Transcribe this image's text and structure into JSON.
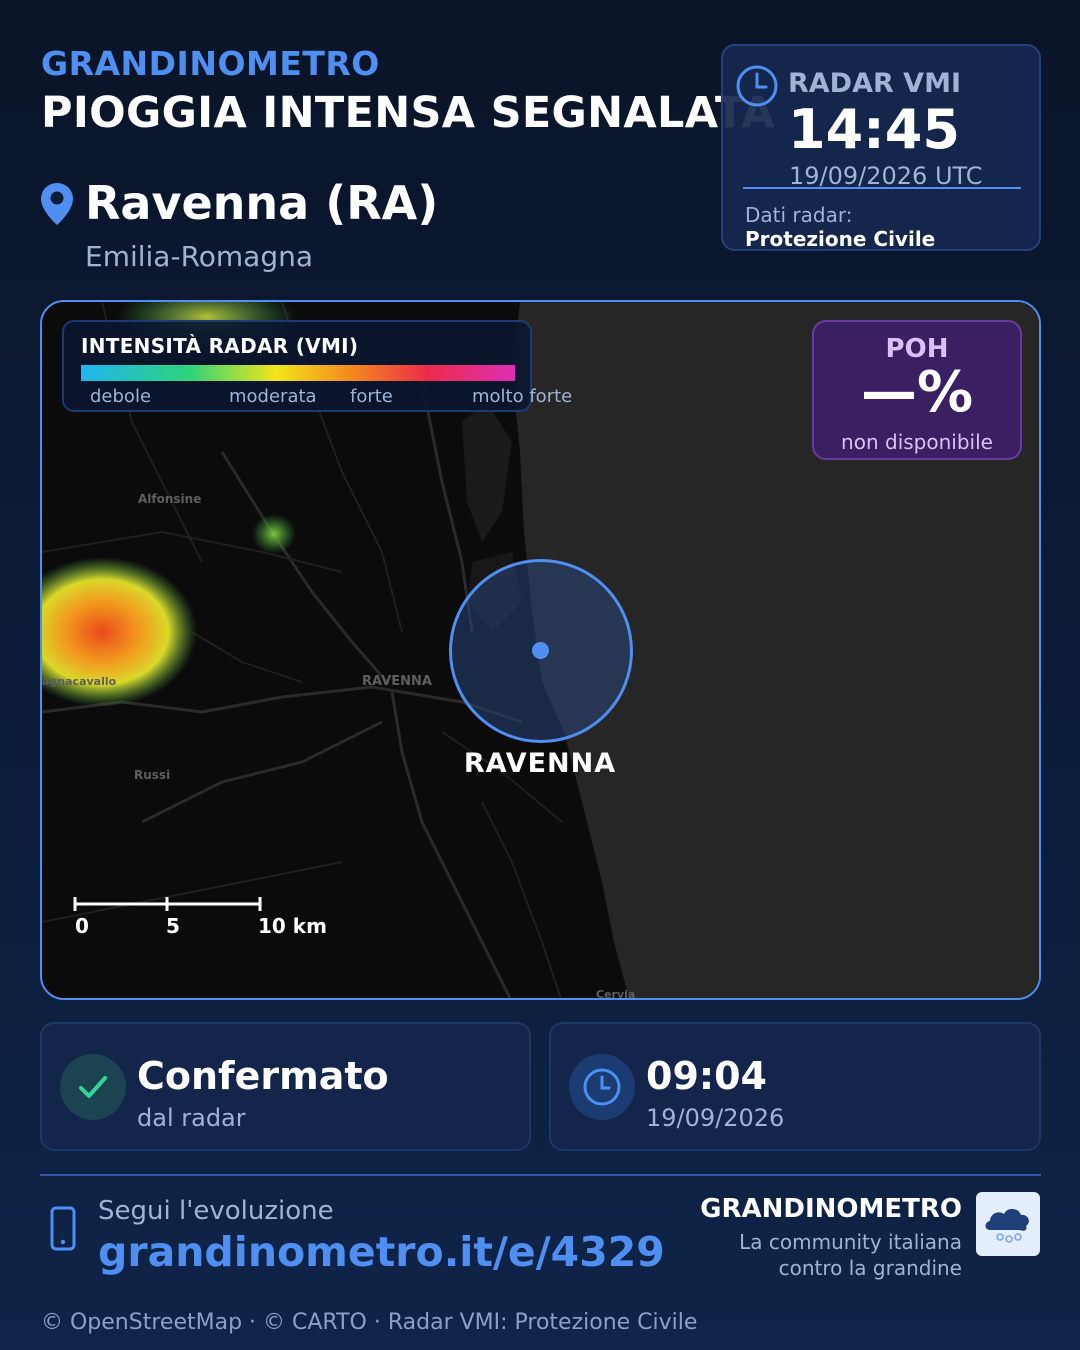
{
  "header": {
    "brand": "GRANDINOMETRO",
    "headline": "PIOGGIA INTENSA SEGNALATA",
    "city": "Ravenna (RA)",
    "region": "Emilia-Romagna"
  },
  "radar_card": {
    "label": "RADAR VMI",
    "time": "14:45",
    "date": "19/09/2026 UTC",
    "source_label": "Dati radar:",
    "source": "Protezione Civile"
  },
  "legend": {
    "title": "INTENSITÀ RADAR (VMI)",
    "labels": [
      "debole",
      "moderata",
      "forte",
      "molto forte"
    ],
    "colors": [
      "#21b5ef",
      "#2fd37a",
      "#f2e51a",
      "#f48a1e",
      "#ec2c4a",
      "#de2eb6"
    ]
  },
  "poh": {
    "label": "POH",
    "value": "—%",
    "note": "non disponibile"
  },
  "map": {
    "location_label": "RAVENNA",
    "scale": [
      "0",
      "5",
      "10 km"
    ],
    "places": [
      "Alfonsine",
      "RAVENNA",
      "Russi",
      "agnacavallo",
      "Cervia"
    ]
  },
  "status_card": {
    "title": "Confermato",
    "subtitle": "dal radar"
  },
  "time_card": {
    "time": "09:04",
    "date": "19/09/2026"
  },
  "footer": {
    "follow": "Segui l'evoluzione",
    "url": "grandinometro.it/e/4329",
    "brand": "GRANDINOMETRO",
    "tagline_1": "La community italiana",
    "tagline_2": "contro la grandine",
    "credits": "© OpenStreetMap · © CARTO · Radar VMI: Protezione Civile"
  },
  "theme": {
    "accent": "#4f8ff2",
    "background": "#0c1d3a",
    "poh_bg": "#3a2063",
    "confirmed": "#34d399"
  },
  "icons": [
    "map-pin-icon",
    "clock-icon",
    "check-icon",
    "phone-icon",
    "hail-cloud-icon"
  ]
}
